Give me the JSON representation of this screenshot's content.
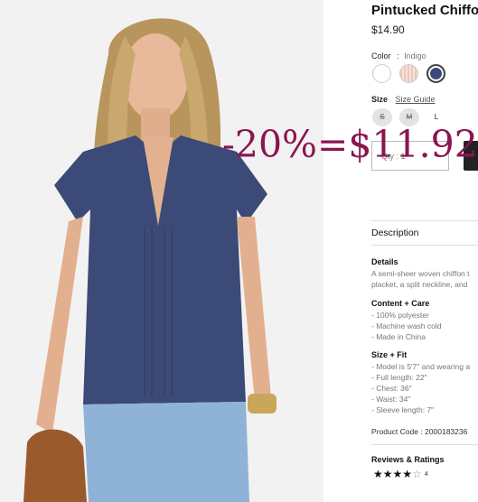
{
  "product": {
    "title": "Pintucked Chiffo",
    "price": "$14.90"
  },
  "color": {
    "label": "Color",
    "separator": ":",
    "selected": "Indigo",
    "swatches": [
      {
        "name": "white",
        "hex": "#ffffff"
      },
      {
        "name": "blush-stripe",
        "hex": "#e9c8bd"
      },
      {
        "name": "indigo",
        "hex": "#3c4877"
      }
    ]
  },
  "size": {
    "label": "Size",
    "guide_label": "Size Guide",
    "options": [
      {
        "label": "S",
        "available": false
      },
      {
        "label": "M",
        "available": false
      },
      {
        "label": "L",
        "available": true
      }
    ]
  },
  "qty": {
    "label": "Qty : 1"
  },
  "description": {
    "heading": "Description",
    "details_title": "Details",
    "details_lines": [
      "A semi-sheer woven chiffon t",
      "placket, a split neckline, and"
    ],
    "content_title": "Content + Care",
    "content_lines": [
      "- 100% polyester",
      "- Machine wash cold",
      "- Made in China"
    ],
    "fit_title": "Size + Fit",
    "fit_lines": [
      "- Model is 5'7\" and wearing a",
      "- Full length: 22\"",
      "- Chest: 36\"",
      "- Waist: 34\"",
      "- Sleeve length: 7\""
    ],
    "product_code": "Product Code : 2000183236"
  },
  "reviews": {
    "title": "Reviews & Ratings",
    "rating": 4,
    "filled_stars": "★★★★",
    "empty_stars": "☆",
    "count": "4"
  },
  "overlay": {
    "text": "-20%=$11.92",
    "color": "#8a1550"
  }
}
